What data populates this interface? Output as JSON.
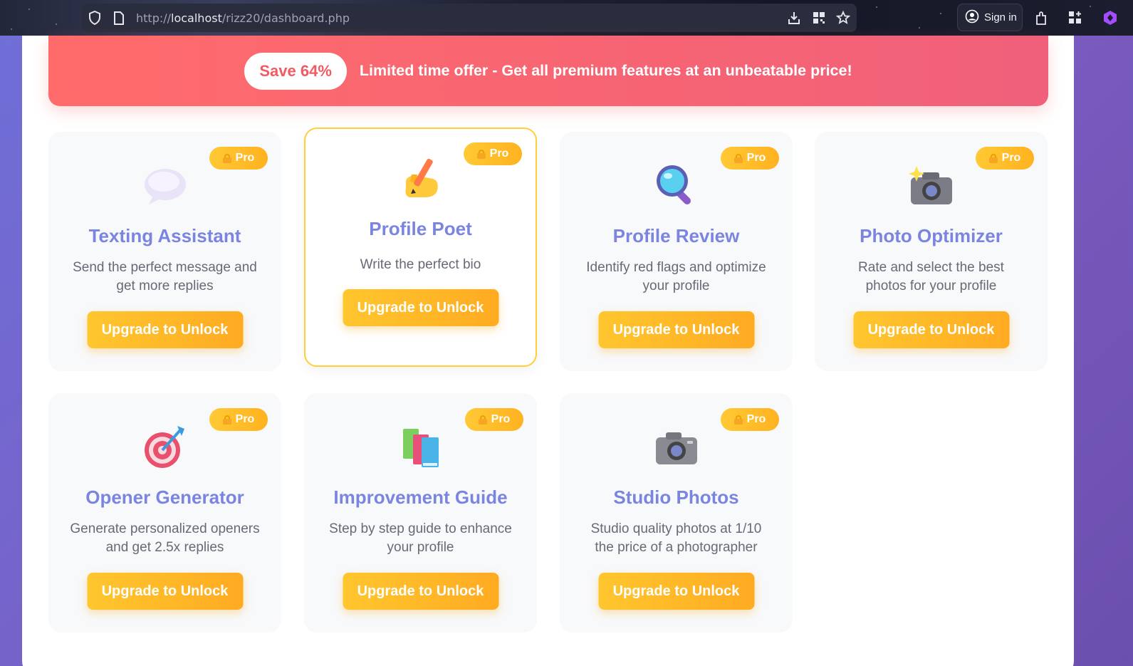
{
  "browser": {
    "url_prefix": "http://",
    "url_host": "localhost",
    "url_path": "/rizz20/dashboard.php",
    "sign_in_label": "Sign in"
  },
  "offer": {
    "badge": "Save 64%",
    "text": "Limited time offer - Get all premium features at an unbeatable price!"
  },
  "cards": [
    {
      "icon": "speech-bubble-icon",
      "badge": "Pro",
      "title": "Texting Assistant",
      "desc": "Send the perfect message and get more replies",
      "button": "Upgrade to Unlock"
    },
    {
      "icon": "writing-hand-icon",
      "badge": "Pro",
      "title": "Profile Poet",
      "desc": "Write the perfect bio",
      "button": "Upgrade to Unlock"
    },
    {
      "icon": "magnifying-glass-icon",
      "badge": "Pro",
      "title": "Profile Review",
      "desc": "Identify red flags and optimize your profile",
      "button": "Upgrade to Unlock"
    },
    {
      "icon": "camera-flash-icon",
      "badge": "Pro",
      "title": "Photo Optimizer",
      "desc": "Rate and select the best photos for your profile",
      "button": "Upgrade to Unlock"
    },
    {
      "icon": "target-icon",
      "badge": "Pro",
      "title": "Opener Generator",
      "desc": "Generate personalized openers and get 2.5x replies",
      "button": "Upgrade to Unlock"
    },
    {
      "icon": "books-icon",
      "badge": "Pro",
      "title": "Improvement Guide",
      "desc": "Step by step guide to enhance your profile",
      "button": "Upgrade to Unlock"
    },
    {
      "icon": "camera-icon",
      "badge": "Pro",
      "title": "Studio Photos",
      "desc": "Studio quality photos at 1/10 the price of a photographer",
      "button": "Upgrade to Unlock"
    }
  ],
  "colors": {
    "accent_title": "#7b85e0",
    "button": "#ffb726",
    "offer_banner": "#ff6b6b",
    "featured_border": "#ffcf3a"
  }
}
